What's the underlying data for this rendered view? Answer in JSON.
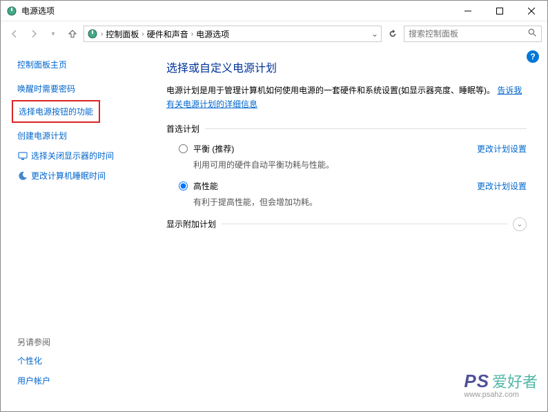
{
  "titlebar": {
    "title": "电源选项"
  },
  "breadcrumb": {
    "items": [
      "控制面板",
      "硬件和声音",
      "电源选项"
    ]
  },
  "search": {
    "placeholder": "搜索控制面板"
  },
  "sidebar": {
    "home": "控制面板主页",
    "links": {
      "wake_pwd": "唤醒时需要密码",
      "power_button": "选择电源按钮的功能",
      "create_plan": "创建电源计划",
      "display_off": "选择关闭显示器的时间",
      "sleep_time": "更改计算机睡眠时间"
    },
    "see_also": "另请参阅",
    "bottom": {
      "personalize": "个性化",
      "user_accounts": "用户帐户"
    }
  },
  "main": {
    "heading": "选择或自定义电源计划",
    "desc_prefix": "电源计划是用于管理计算机如何使用电源的一套硬件和系统设置(如显示器亮度、睡眠等)。",
    "desc_link": "告诉我有关电源计划的详细信息",
    "preferred_label": "首选计划",
    "plans": {
      "balanced": {
        "title": "平衡 (推荐)",
        "desc": "利用可用的硬件自动平衡功耗与性能。",
        "change": "更改计划设置"
      },
      "high": {
        "title": "高性能",
        "desc": "有利于提高性能，但会增加功耗。",
        "change": "更改计划设置"
      }
    },
    "additional_label": "显示附加计划"
  },
  "watermark": {
    "brand_en": "PS",
    "brand_cn": "爱好者",
    "url": "www.psahz.com"
  }
}
